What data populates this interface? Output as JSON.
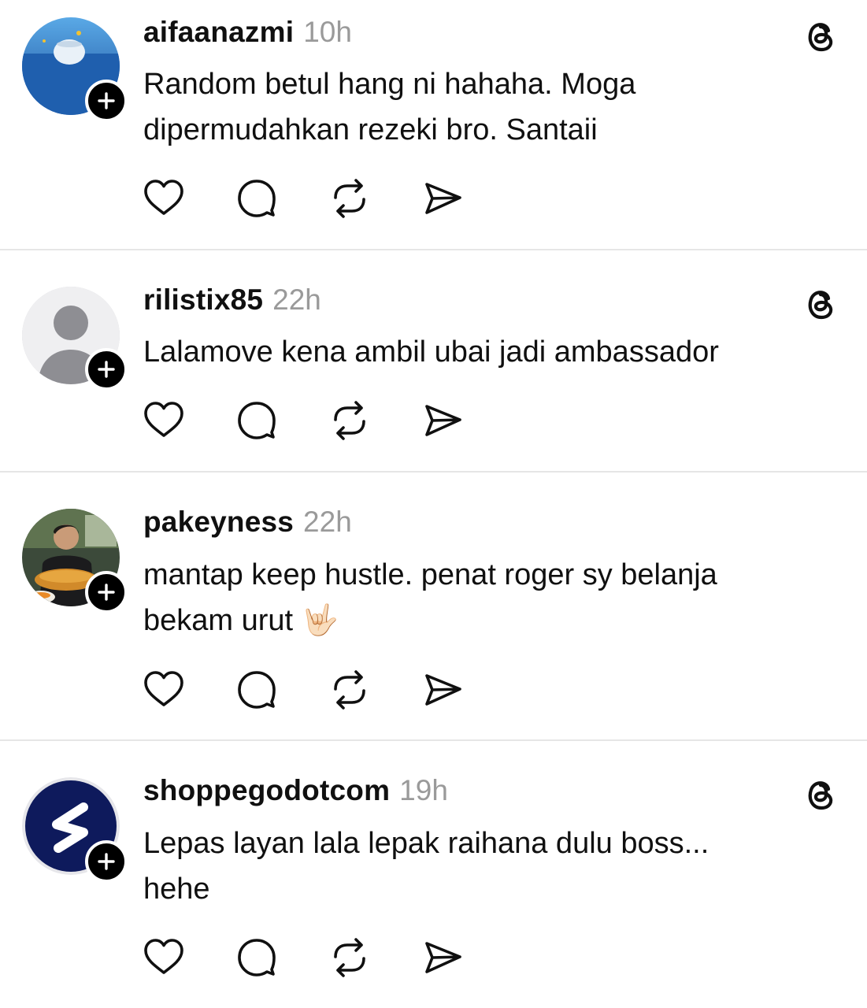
{
  "posts": [
    {
      "username": "aifaanazmi",
      "time": "10h",
      "lines": [
        "Random betul hang ni hahaha. Moga",
        "dipermudahkan rezeki bro. Santaii"
      ],
      "avatar": "avatar-ocean-photo",
      "show_threads_icon": true
    },
    {
      "username": "rilistix85",
      "time": "22h",
      "lines": [
        "Lalamove kena ambil ubai jadi ambassador"
      ],
      "avatar": "avatar-default-person",
      "show_threads_icon": true
    },
    {
      "username": "pakeyness",
      "time": "22h",
      "lines": [
        "mantap keep hustle. penat roger sy belanja",
        "bekam urut 🤟🏻"
      ],
      "avatar": "avatar-person-photo",
      "show_threads_icon": false
    },
    {
      "username": "shoppegodotcom",
      "time": "19h",
      "lines": [
        "Lepas layan lala lepak raihana dulu boss...",
        "hehe"
      ],
      "avatar": "avatar-logo-s",
      "show_threads_icon": true
    }
  ],
  "icons": {
    "like": "heart-icon",
    "reply": "comment-icon",
    "repost": "repost-icon",
    "share": "send-icon",
    "threads": "threads-logo-icon",
    "follow": "plus-icon"
  },
  "colors": {
    "text": "#101010",
    "muted": "#9a9a9a",
    "divider": "#e6e6e6",
    "badge": "#000000"
  }
}
